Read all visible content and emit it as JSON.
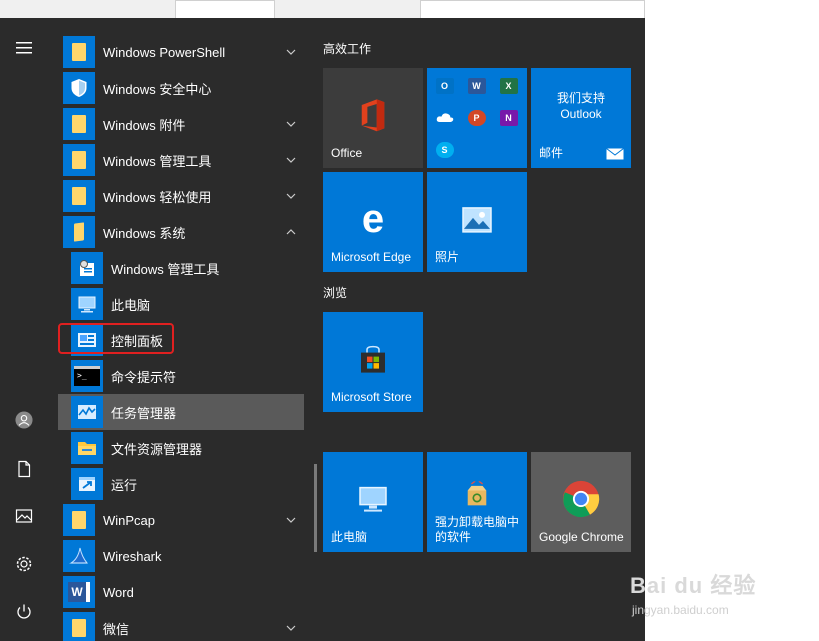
{
  "rail": {
    "icons": [
      "hamburger-icon",
      "user-icon",
      "document-icon",
      "pictures-icon",
      "settings-icon",
      "power-icon"
    ]
  },
  "apps": [
    {
      "label": "Windows PowerShell",
      "icon": "folder-icon",
      "expandable": true
    },
    {
      "label": "Windows 安全中心",
      "icon": "shield-icon",
      "expandable": false
    },
    {
      "label": "Windows 附件",
      "icon": "folder-icon",
      "expandable": true
    },
    {
      "label": "Windows 管理工具",
      "icon": "folder-icon",
      "expandable": true
    },
    {
      "label": "Windows 轻松使用",
      "icon": "folder-icon",
      "expandable": true
    },
    {
      "label": "Windows 系统",
      "icon": "folder-open-icon",
      "expandable": true,
      "expanded": true
    },
    {
      "label": "Windows 管理工具",
      "icon": "admin-tools-icon",
      "sub": true
    },
    {
      "label": "此电脑",
      "icon": "this-pc-icon",
      "sub": true
    },
    {
      "label": "控制面板",
      "icon": "control-panel-icon",
      "sub": true,
      "highlighted_box": true
    },
    {
      "label": "命令提示符",
      "icon": "cmd-icon",
      "sub": true
    },
    {
      "label": "任务管理器",
      "icon": "task-manager-icon",
      "sub": true,
      "hover": true
    },
    {
      "label": "文件资源管理器",
      "icon": "file-explorer-icon",
      "sub": true
    },
    {
      "label": "运行",
      "icon": "run-icon",
      "sub": true
    },
    {
      "label": "WinPcap",
      "icon": "folder-icon",
      "expandable": true
    },
    {
      "label": "Wireshark",
      "icon": "wireshark-icon",
      "expandable": false
    },
    {
      "label": "Word",
      "icon": "word-icon",
      "expandable": false
    },
    {
      "label": "微信",
      "icon": "folder-icon",
      "expandable": true
    }
  ],
  "groups": {
    "productivity": "高效工作",
    "browse": "浏览"
  },
  "tiles": {
    "office": "Office",
    "outlook_line1": "我们支持",
    "outlook_line2": "Outlook",
    "mail": "邮件",
    "edge": "Microsoft Edge",
    "photos": "照片",
    "store": "Microsoft Store",
    "this_pc": "此电脑",
    "uninstall_line1": "强力卸载电脑中",
    "uninstall_line2": "的软件",
    "chrome": "Google Chrome"
  },
  "mini_apps": [
    {
      "name": "outlook",
      "letter": "O",
      "color": "#0072c6"
    },
    {
      "name": "word",
      "letter": "W",
      "color": "#2b579a"
    },
    {
      "name": "excel",
      "letter": "X",
      "color": "#217346"
    },
    {
      "name": "onedrive",
      "letter": "",
      "color": "#0078d7"
    },
    {
      "name": "powerpoint",
      "letter": "P",
      "color": "#d24726"
    },
    {
      "name": "onenote",
      "letter": "N",
      "color": "#7719aa"
    },
    {
      "name": "skype",
      "letter": "S",
      "color": "#00aff0"
    }
  ],
  "watermark": {
    "logo": "Bai du 经验",
    "url": "jingyan.baidu.com"
  },
  "colors": {
    "menu_bg": "#2b2b2b",
    "tile_blue": "#0078d7",
    "highlight_box": "#e02020",
    "hover_bg": "#5a5a5a"
  }
}
